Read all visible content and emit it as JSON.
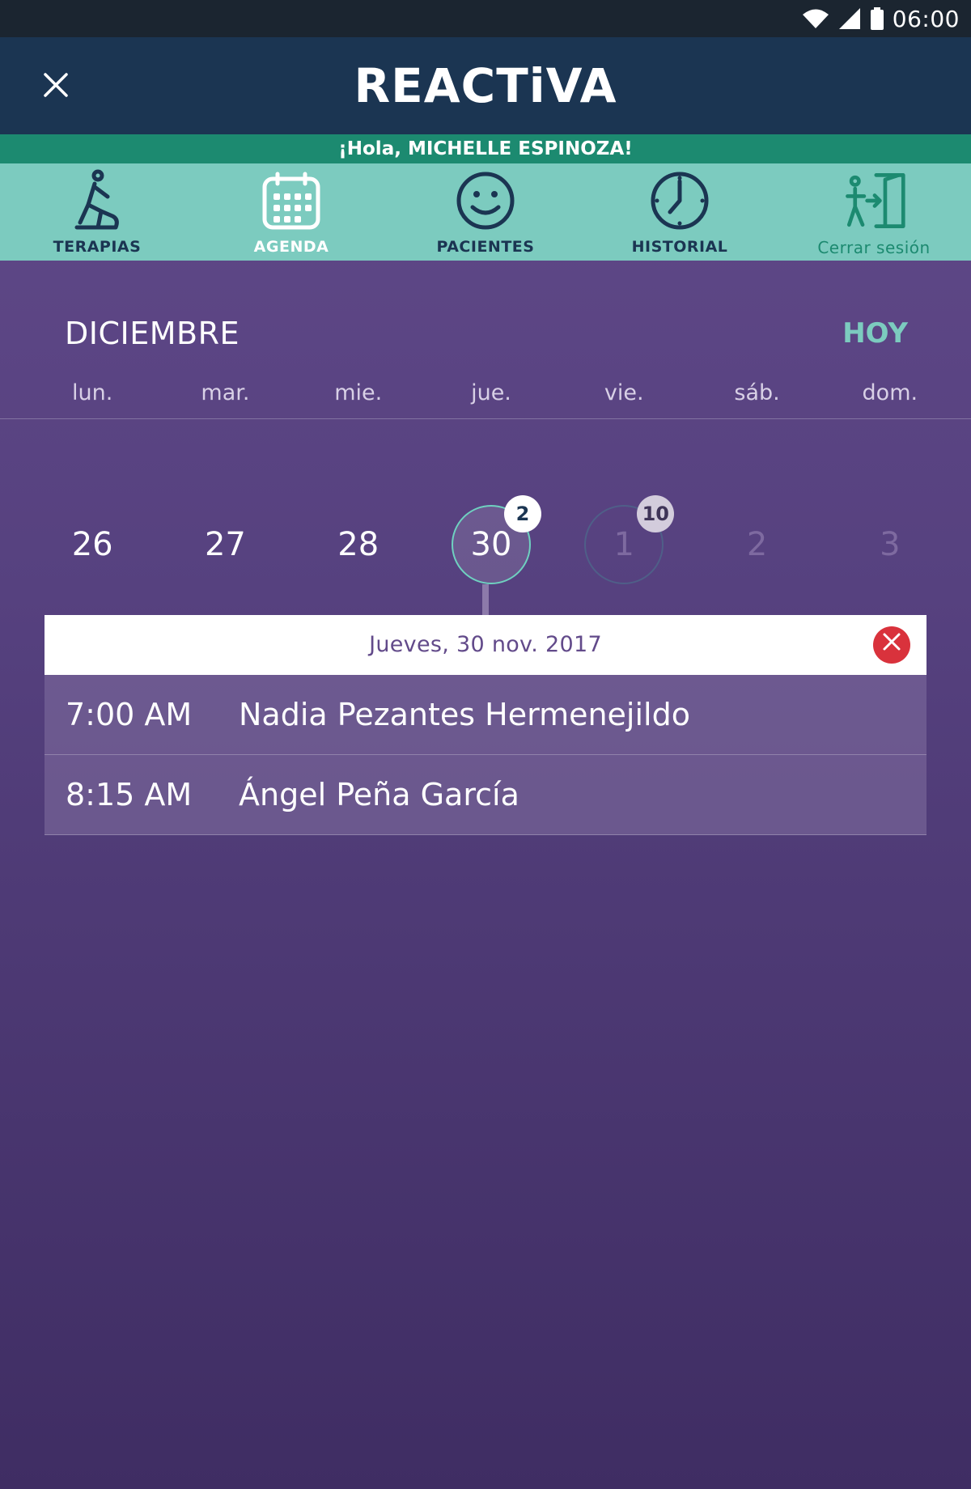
{
  "status": {
    "time": "06:00",
    "icons": [
      "wifi-icon",
      "signal-icon",
      "battery-icon"
    ]
  },
  "app": {
    "logo": "REACTiVA",
    "close_icon": "close-icon"
  },
  "greeting": "¡Hola, MICHELLE ESPINOZA!",
  "nav": {
    "items": [
      {
        "label": "TERAPIAS",
        "icon": "therapy-icon",
        "active": false
      },
      {
        "label": "AGENDA",
        "icon": "calendar-icon",
        "active": true
      },
      {
        "label": "PACIENTES",
        "icon": "smiley-icon",
        "active": false
      },
      {
        "label": "HISTORIAL",
        "icon": "clock-icon",
        "active": false
      },
      {
        "label": "Cerrar sesión",
        "icon": "exit-door-icon",
        "active": false
      }
    ]
  },
  "calendar": {
    "month": "DICIEMBRE",
    "today_label": "HOY",
    "weekdays": [
      "lun.",
      "mar.",
      "mie.",
      "jue.",
      "vie.",
      "sáb.",
      "dom."
    ],
    "days": [
      {
        "num": "26",
        "state": "normal",
        "badge": null
      },
      {
        "num": "27",
        "state": "normal",
        "badge": null
      },
      {
        "num": "28",
        "state": "normal",
        "badge": null
      },
      {
        "num": "30",
        "state": "selected",
        "badge": "2"
      },
      {
        "num": "1",
        "state": "outline",
        "badge": "10"
      },
      {
        "num": "2",
        "state": "dim",
        "badge": null
      },
      {
        "num": "3",
        "state": "dim",
        "badge": null
      }
    ]
  },
  "panel": {
    "date": "Jueves, 30 nov. 2017",
    "appointments": [
      {
        "time": "7:00 AM",
        "name": "Nadia Pezantes Hermenejildo"
      },
      {
        "time": "8:15 AM",
        "name": "Ángel Peña García"
      }
    ]
  },
  "colors": {
    "app_bar": "#1b3552",
    "greeting_bar": "#1c8a70",
    "nav_bar": "#7ccbbf",
    "accent_teal": "#7ccbbf",
    "background_purple": "#624a8a",
    "close_red": "#d9323c"
  }
}
